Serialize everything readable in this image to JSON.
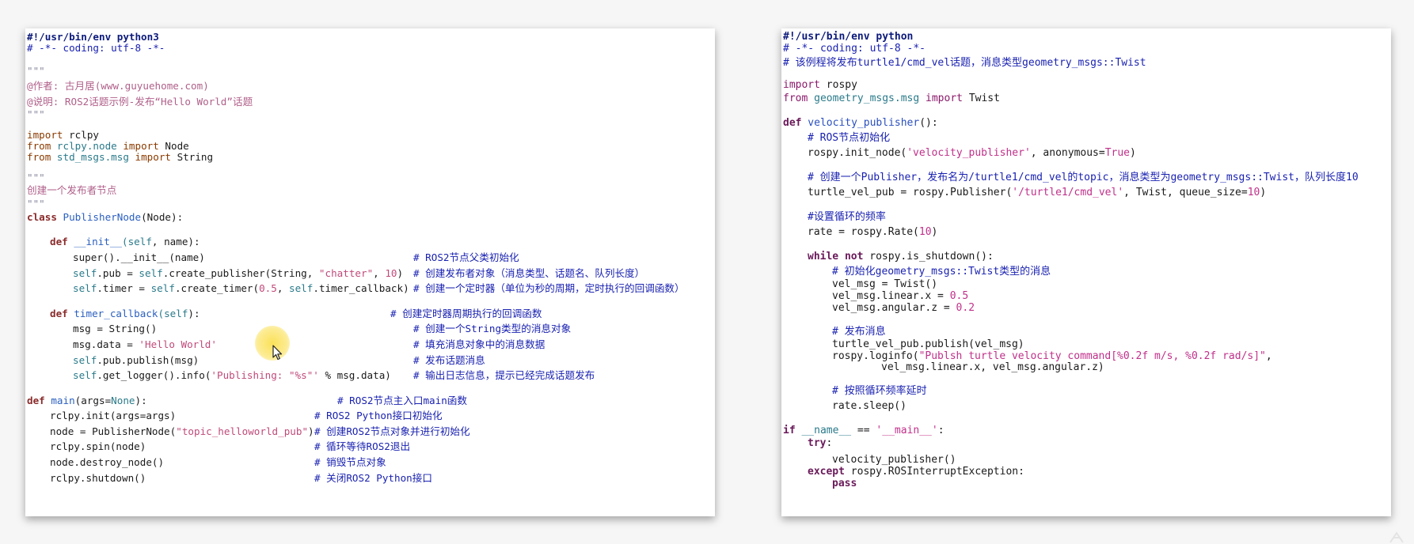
{
  "left": {
    "shebang": "#!/usr/bin/env python3",
    "coding": "# -*- coding: utf-8 -*-",
    "triple_quote": "\"\"\"",
    "author": "@作者: 古月居(www.guyuehome.com)",
    "desc": "@说明: ROS2话题示例-发布“Hello World”话题",
    "imp1_kw": "import",
    "imp1_mod": " rclpy",
    "imp2_from": "from",
    "imp2_mod": " rclpy.node ",
    "imp2_import": "import",
    "imp2_name": " Node",
    "imp3_from": "from",
    "imp3_mod": " std_msgs.msg ",
    "imp3_import": "import",
    "imp3_name": " String",
    "create_node_doc": "创建一个发布者节点",
    "class_kw": "class",
    "class_name": " PublisherNode",
    "class_rest": "(Node):",
    "def1": "def",
    "init_name": " __init__",
    "init_args_self": "(self",
    "init_args_rest": ", name):",
    "super_call": "super().__init__(name)",
    "cmt_super": "# ROS2节点父类初始化",
    "pub_self": "self",
    "pub_mid": ".pub = ",
    "pub_self2": "self",
    "pub_call": ".create_publisher(String, ",
    "pub_str": "\"chatter\"",
    "pub_sep": ", ",
    "pub_num": "10",
    "pub_end": ")",
    "cmt_pub": "# 创建发布者对象（消息类型、话题名、队列长度）",
    "timer_self": "self",
    "timer_mid": ".timer = ",
    "timer_self2": "self",
    "timer_call": ".create_timer(",
    "timer_num": "0.5",
    "timer_sep": ", ",
    "timer_self3": "self",
    "timer_end": ".timer_callback)",
    "cmt_timer": "# 创建一个定时器（单位为秒的周期，定时执行的回调函数）",
    "def2": "def",
    "cb_name": " timer_callback",
    "cb_args_self": "(self",
    "cb_args_rest": "):",
    "cmt_cb": "# 创建定时器周期执行的回调函数",
    "msg_line": "msg = String()",
    "cmt_msg": "# 创建一个String类型的消息对象",
    "data_pre": "msg.data = ",
    "data_str": "'Hello World'",
    "cmt_data": "# 填充消息对象中的消息数据",
    "publish_self": "self",
    "publish_rest": ".pub.publish(msg)",
    "cmt_publish": "# 发布话题消息",
    "log_self": "self",
    "log_mid": ".get_logger().info(",
    "log_str": "'Publishing: \"%s\"'",
    "log_end": " % msg.data)",
    "cmt_log": "# 输出日志信息，提示已经完成话题发布",
    "def3": "def",
    "main_name": " main",
    "main_args": "(args=",
    "main_none": "None",
    "main_end": "):",
    "cmt_main": "# ROS2节点主入口main函数",
    "init_line": "rclpy.init(args=args)",
    "cmt_init": "# ROS2 Python接口初始化",
    "node_pre": "node = PublisherNode(",
    "node_str": "\"topic_helloworld_pub\"",
    "node_end": ")",
    "cmt_node": "# 创建ROS2节点对象并进行初始化",
    "spin_line": "rclpy.spin(node)",
    "cmt_spin": "# 循环等待ROS2退出",
    "destroy_line": "node.destroy_node()",
    "cmt_destroy": "# 销毁节点对象",
    "shutdown_line": "rclpy.shutdown()",
    "cmt_shutdown": "# 关闭ROS2 Python接口"
  },
  "right": {
    "shebang": "#!/usr/bin/env python",
    "coding": "# -*- coding: utf-8 -*-",
    "header_cmt": "# 该例程将发布turtle1/cmd_vel话题，消息类型geometry_msgs::Twist",
    "imp1_kw": "import",
    "imp1_mod": " rospy",
    "imp2_from": "from",
    "imp2_mod": " geometry_msgs.msg ",
    "imp2_import": "import",
    "imp2_name": " Twist",
    "def_kw": "def",
    "def_name": " velocity_publisher",
    "def_end": "():",
    "cmt_init": "# ROS节点初始化",
    "init_pre": "rospy.init_node(",
    "init_str": "'velocity_publisher'",
    "init_mid": ", anonymous=",
    "init_true": "True",
    "init_end": ")",
    "cmt_pub": "# 创建一个Publisher，发布名为/turtle1/cmd_vel的topic，消息类型为geometry_msgs::Twist，队列长度10",
    "pub_pre": "turtle_vel_pub = rospy.Publisher(",
    "pub_str": "'/turtle1/cmd_vel'",
    "pub_mid": ", Twist, queue_size=",
    "pub_num": "10",
    "pub_end": ")",
    "cmt_rate": "#设置循环的频率",
    "rate_pre": "rate = rospy.Rate(",
    "rate_num": "10",
    "rate_end": ")",
    "while_kw": "while",
    "while_not": " not",
    "while_rest": " rospy.is_shutdown():",
    "cmt_twist": "# 初始化geometry_msgs::Twist类型的消息",
    "vel_msg": "vel_msg = Twist()",
    "lin_pre": "vel_msg.linear.x = ",
    "lin_num": "0.5",
    "ang_pre": "vel_msg.angular.z = ",
    "ang_num": "0.2",
    "cmt_publish": "# 发布消息",
    "publish_line": "turtle_vel_pub.publish(vel_msg)",
    "log_pre": "rospy.loginfo(",
    "log_str": "\"Publsh turtle velocity command[%0.2f m/s, %0.2f rad/s]\"",
    "log_end": ",",
    "log_cont": "vel_msg.linear.x, vel_msg.angular.z)",
    "cmt_sleep": "# 按照循环频率延时",
    "sleep_line": "rate.sleep()",
    "if_kw": "if",
    "if_name": " __name__",
    "if_mid": " == ",
    "if_str": "'__main__'",
    "if_end": ":",
    "try_kw": "try",
    "try_colon": ":",
    "call_line": "velocity_publisher()",
    "except_kw": "except",
    "except_rest": " rospy.ROSInterruptException:",
    "pass_kw": "pass"
  }
}
